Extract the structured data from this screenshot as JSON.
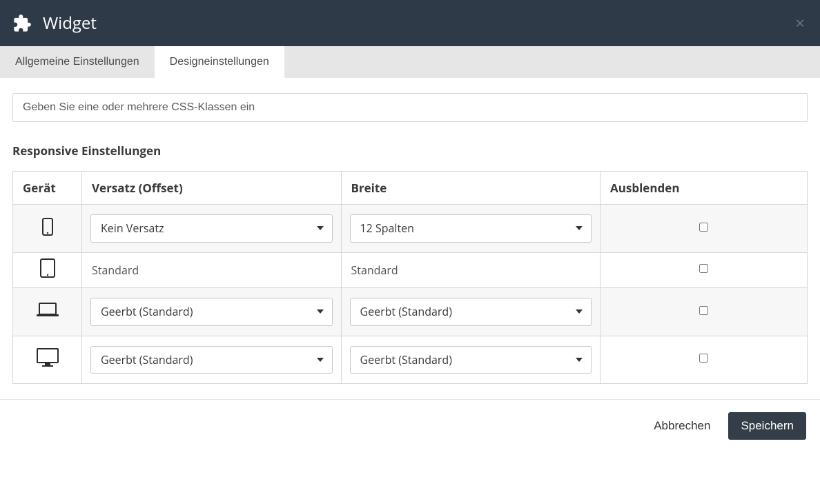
{
  "header": {
    "title": "Widget"
  },
  "tabs": {
    "general": "Allgemeine Einstellungen",
    "design": "Designeinstellungen"
  },
  "css_input": {
    "placeholder": "Geben Sie eine oder mehrere CSS-Klassen ein"
  },
  "responsive": {
    "title": "Responsive Einstellungen",
    "headers": {
      "device": "Gerät",
      "offset": "Versatz (Offset)",
      "width": "Breite",
      "hide": "Ausblenden"
    },
    "rows": [
      {
        "offset_type": "select",
        "offset_value": "Kein Versatz",
        "width_type": "select",
        "width_value": "12 Spalten"
      },
      {
        "offset_type": "text",
        "offset_value": "Standard",
        "width_type": "text",
        "width_value": "Standard"
      },
      {
        "offset_type": "select",
        "offset_value": "Geerbt (Standard)",
        "width_type": "select",
        "width_value": "Geerbt (Standard)"
      },
      {
        "offset_type": "select",
        "offset_value": "Geerbt (Standard)",
        "width_type": "select",
        "width_value": "Geerbt (Standard)"
      }
    ]
  },
  "footer": {
    "cancel": "Abbrechen",
    "save": "Speichern"
  }
}
